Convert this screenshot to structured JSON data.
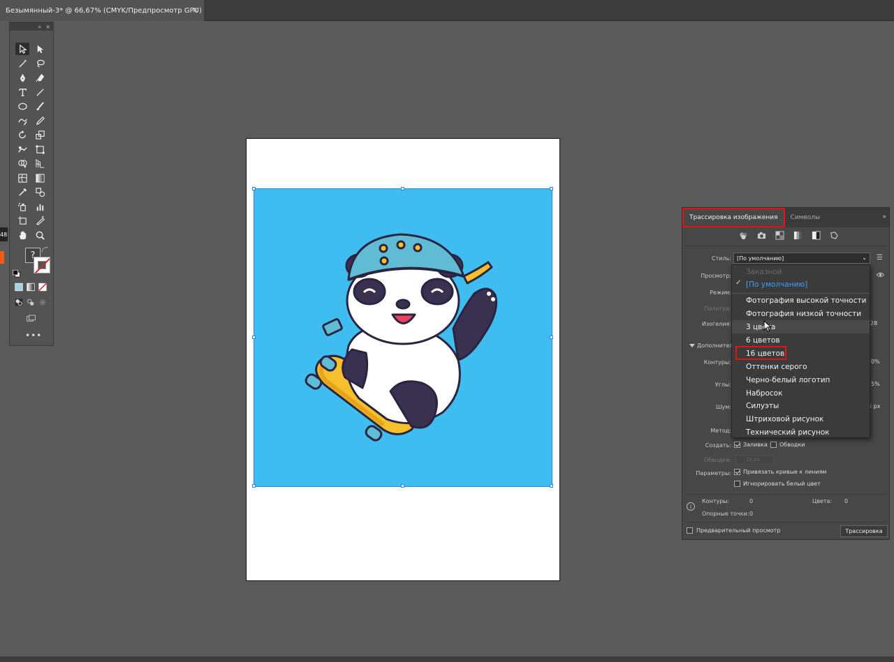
{
  "document": {
    "tab_title": "Безымянный-3* @ 66,67% (CMYK/Предпросмотр GPU)",
    "close_glyph": "✕"
  },
  "tools_panel": {
    "collapse_glyph": "«",
    "close_glyph": "×",
    "unknown_fill_glyph": "?",
    "more_glyph": "•••"
  },
  "left_edge": {
    "badge": "48"
  },
  "trace_panel": {
    "tabs": [
      {
        "label": "Трассировка изображения",
        "active": true
      },
      {
        "label": "Символы",
        "active": false
      }
    ],
    "collapse_glyph": "»",
    "presets": [
      "auto-color-icon",
      "high-color-icon",
      "low-color-icon",
      "grayscale-icon",
      "black-white-icon",
      "outline-icon"
    ],
    "labels": {
      "style": "Стиль:",
      "view": "Просмотр:",
      "mode": "Режим:",
      "palette": "Палитра:",
      "isolines": "Изогелия:",
      "advanced": "Дополнитель",
      "contours": "Контуры:",
      "corners": "Углы:",
      "noise": "Шум:",
      "method": "Метод:",
      "create": "Создать:",
      "strokes_width": "Обводки:",
      "params": "Параметры:"
    },
    "style_value": "[По умолчанию]",
    "stub_values": {
      "isolines": "28",
      "contours": "0%",
      "corners": "5%",
      "noise": "5 px"
    },
    "stroke_width_value": "10 px",
    "create_fill": "Заливка",
    "create_strokes": "Обводки",
    "snap_curves": "Привязать кривые к линиям",
    "ignore_white": "Игнорировать белый цвет",
    "stats": {
      "paths_label": "Контуры:",
      "paths_value": "0",
      "colors_label": "Цвета:",
      "colors_value": "0",
      "anchors_label": "Опорные точки:",
      "anchors_value": "0"
    },
    "preview_label": "Предварительный просмотр",
    "trace_button": "Трассировка"
  },
  "style_dropdown": {
    "items": [
      {
        "label": "Заказной",
        "state": "disabled"
      },
      {
        "label": "[По умолчанию]",
        "state": "selected"
      },
      {
        "label": "Фотография высокой точности",
        "state": "normal"
      },
      {
        "label": "Фотография низкой точности",
        "state": "normal"
      },
      {
        "label": "3 цвета",
        "state": "hover"
      },
      {
        "label": "6 цветов",
        "state": "normal"
      },
      {
        "label": "16 цветов",
        "state": "highlighted"
      },
      {
        "label": "Оттенки серого",
        "state": "normal"
      },
      {
        "label": "Черно-белый логотип",
        "state": "normal"
      },
      {
        "label": "Набросок",
        "state": "normal"
      },
      {
        "label": "Силуэты",
        "state": "normal"
      },
      {
        "label": "Штриховой рисунок",
        "state": "normal"
      },
      {
        "label": "Технический рисунок",
        "state": "normal"
      }
    ],
    "checkmark": "✓"
  },
  "colors": {
    "highlight_red": "#e01515",
    "image_background": "#40bdf0",
    "selection_blue": "#2b86e8"
  }
}
